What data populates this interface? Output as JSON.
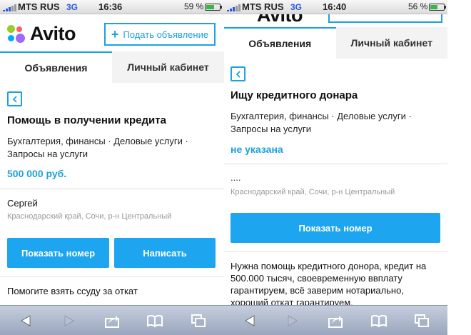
{
  "colors": {
    "accent": "#1da1e0",
    "button": "#1ea5f0",
    "muted": "#9a9a9a"
  },
  "left": {
    "status": {
      "carrier": "MTS RUS",
      "network": "3G",
      "time": "16:36",
      "battery": "59 %",
      "battery_level": 0.59
    },
    "header": {
      "logo_text": "Avito",
      "post_button_plus": "+",
      "post_button_label": "Подать объявление"
    },
    "tabs": {
      "ads": "Объявления",
      "cabinet": "Личный кабинет"
    },
    "ad": {
      "title": "Помощь в получении кредита",
      "category_line1": "Бухгалтерия, финансы · Деловые услуги ·",
      "category_line2": "Запросы на услуги",
      "price": "500 000 руб.",
      "seller": "Сергей",
      "location": "Краснодарский край, Сочи, р-н Центральный",
      "show_number_label": "Показать номер",
      "write_label": "Написать",
      "description": "Помогите взять ссуду за откат"
    }
  },
  "right": {
    "status": {
      "carrier": "MTS RUS",
      "network": "3G",
      "time": "16:40",
      "battery": "56 %",
      "battery_level": 0.56
    },
    "header": {
      "logo_text": "Avito"
    },
    "tabs": {
      "ads": "Объявления",
      "cabinet": "Личный кабинет"
    },
    "ad": {
      "title": "Ищу кредитного донара",
      "category_line1": "Бухгалтерия, финансы · Деловые услуги ·",
      "category_line2": "Запросы на услуги",
      "price": "не указана",
      "seller": "....",
      "location": "Краснодарский край, Сочи, р-н Центральный",
      "show_number_label": "Показать номер",
      "desc_line1": "Нужна помощь кредитного донора, кредит на",
      "desc_line2": "500.000 тысяч, своевременную ввплату",
      "desc_line3": "гарантируем, всё заверим нотариально,",
      "desc_line4": "хороший откат гарантируем."
    }
  },
  "toolbar_icons": [
    "back-arrow-icon",
    "forward-arrow-icon",
    "share-icon",
    "bookmarks-icon",
    "tabs-icon"
  ]
}
